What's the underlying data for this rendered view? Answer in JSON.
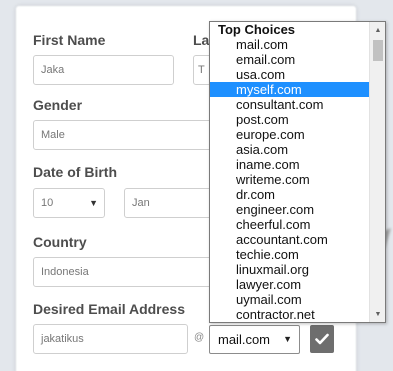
{
  "form": {
    "first_name_label": "First Name",
    "last_name_label_fragment": "La",
    "first_name_value": "Jaka",
    "last_name_value_fragment": "T",
    "gender_label": "Gender",
    "gender_value": "Male",
    "dob_label": "Date of Birth",
    "dob_day": "10",
    "dob_month": "Jan",
    "country_label": "Country",
    "country_value": "Indonesia",
    "email_label": "Desired Email Address",
    "email_username": "jakatikus",
    "at_sign": "@"
  },
  "email_select": {
    "selected": "mail.com",
    "arrow": "▼"
  },
  "dropdown": {
    "group_label": "Top Choices",
    "options": [
      "mail.com",
      "email.com",
      "usa.com",
      "myself.com",
      "consultant.com",
      "post.com",
      "europe.com",
      "asia.com",
      "iname.com",
      "writeme.com",
      "dr.com",
      "engineer.com",
      "cheerful.com",
      "accountant.com",
      "techie.com",
      "linuxmail.org",
      "lawyer.com",
      "uymail.com",
      "contractor.net"
    ],
    "highlighted_option": "myself.com"
  },
  "icons": {
    "submit": "check-icon",
    "scroll_up": "chevron-up-icon",
    "scroll_down": "chevron-down-icon"
  },
  "colors": {
    "highlight": "#1e90ff",
    "button": "#6e6e6e"
  }
}
